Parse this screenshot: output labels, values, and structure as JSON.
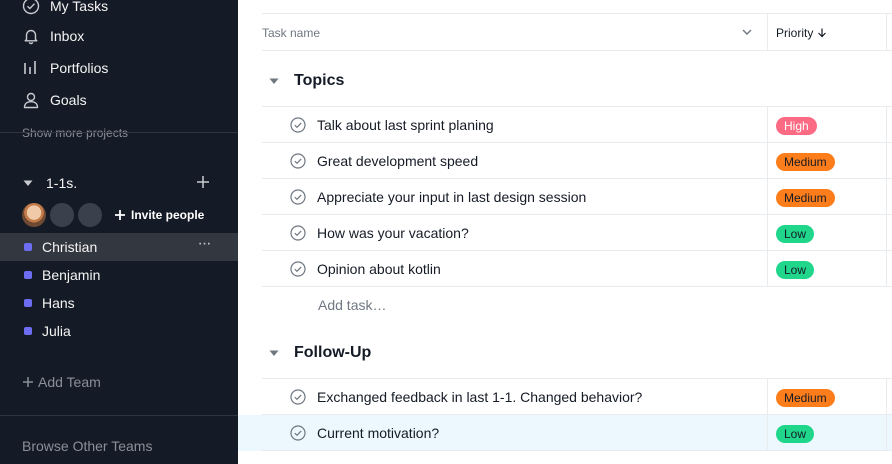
{
  "sidebar": {
    "nav": [
      {
        "label": "My Tasks",
        "icon": "check-circle-icon"
      },
      {
        "label": "Inbox",
        "icon": "bell-icon"
      },
      {
        "label": "Portfolios",
        "icon": "bar-chart-icon"
      },
      {
        "label": "Goals",
        "icon": "person-icon"
      }
    ],
    "show_more": "Show more projects",
    "team": {
      "name": "1-1s.",
      "invite_label": "Invite people",
      "members": [
        {
          "name": "Christian",
          "active": true
        },
        {
          "name": "Benjamin"
        },
        {
          "name": "Hans"
        },
        {
          "name": "Julia"
        }
      ]
    },
    "add_team": "Add Team",
    "browse_teams": "Browse Other Teams"
  },
  "list": {
    "columns": {
      "task": "Task name",
      "priority": "Priority"
    },
    "sections": [
      {
        "title": "Topics",
        "tasks": [
          {
            "name": "Talk about last sprint planing",
            "priority": "High"
          },
          {
            "name": "Great development speed",
            "priority": "Medium"
          },
          {
            "name": "Appreciate your input in last design session",
            "priority": "Medium"
          },
          {
            "name": "How was your vacation?",
            "priority": "Low"
          },
          {
            "name": "Opinion about kotlin",
            "priority": "Low"
          }
        ],
        "add_task": "Add task…"
      },
      {
        "title": "Follow-Up",
        "tasks": [
          {
            "name": "Exchanged feedback in last 1-1. Changed behavior?",
            "priority": "Medium"
          },
          {
            "name": "Current motivation?",
            "priority": "Low"
          }
        ]
      }
    ]
  },
  "colors": {
    "sidebar_bg": "#151b26",
    "member_dot": "#6d6df2",
    "priority_high": "#fc6b83",
    "priority_medium": "#fd7d1a",
    "priority_low": "#1fd68b",
    "row_highlight": "#edf8fe"
  }
}
